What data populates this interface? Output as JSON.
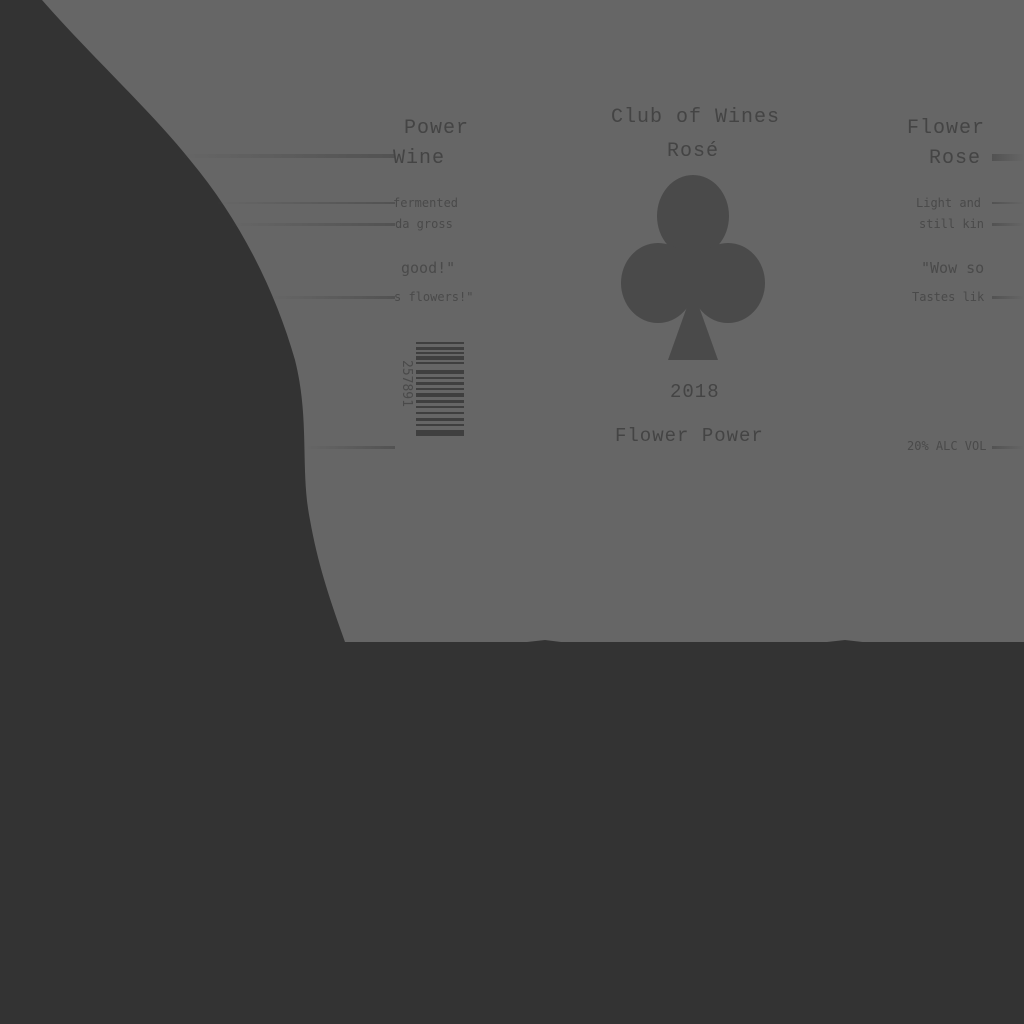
{
  "colors": {
    "background": "#333333",
    "label": "#666666",
    "ink": "#464646"
  },
  "center_panel": {
    "brand": "Club of Wines",
    "style": "Rosé",
    "emblem": "club-suit-icon",
    "year": "2018",
    "name": "Flower Power"
  },
  "left_panel": {
    "title_line1": "Power",
    "title_line2": "Wine",
    "desc_line1": "fermented",
    "desc_line2": "da gross",
    "quote_line1": "good!\"",
    "quote_line2": "s flowers!\"",
    "barcode_number": "257891"
  },
  "right_panel": {
    "title_line1": "Flower",
    "title_line2": "Rose",
    "desc_line1": "Light and",
    "desc_line2": "still  kin",
    "quote_line1": "\"Wow so",
    "quote_line2": "Tastes lik",
    "abv": "20% ALC VOL"
  }
}
